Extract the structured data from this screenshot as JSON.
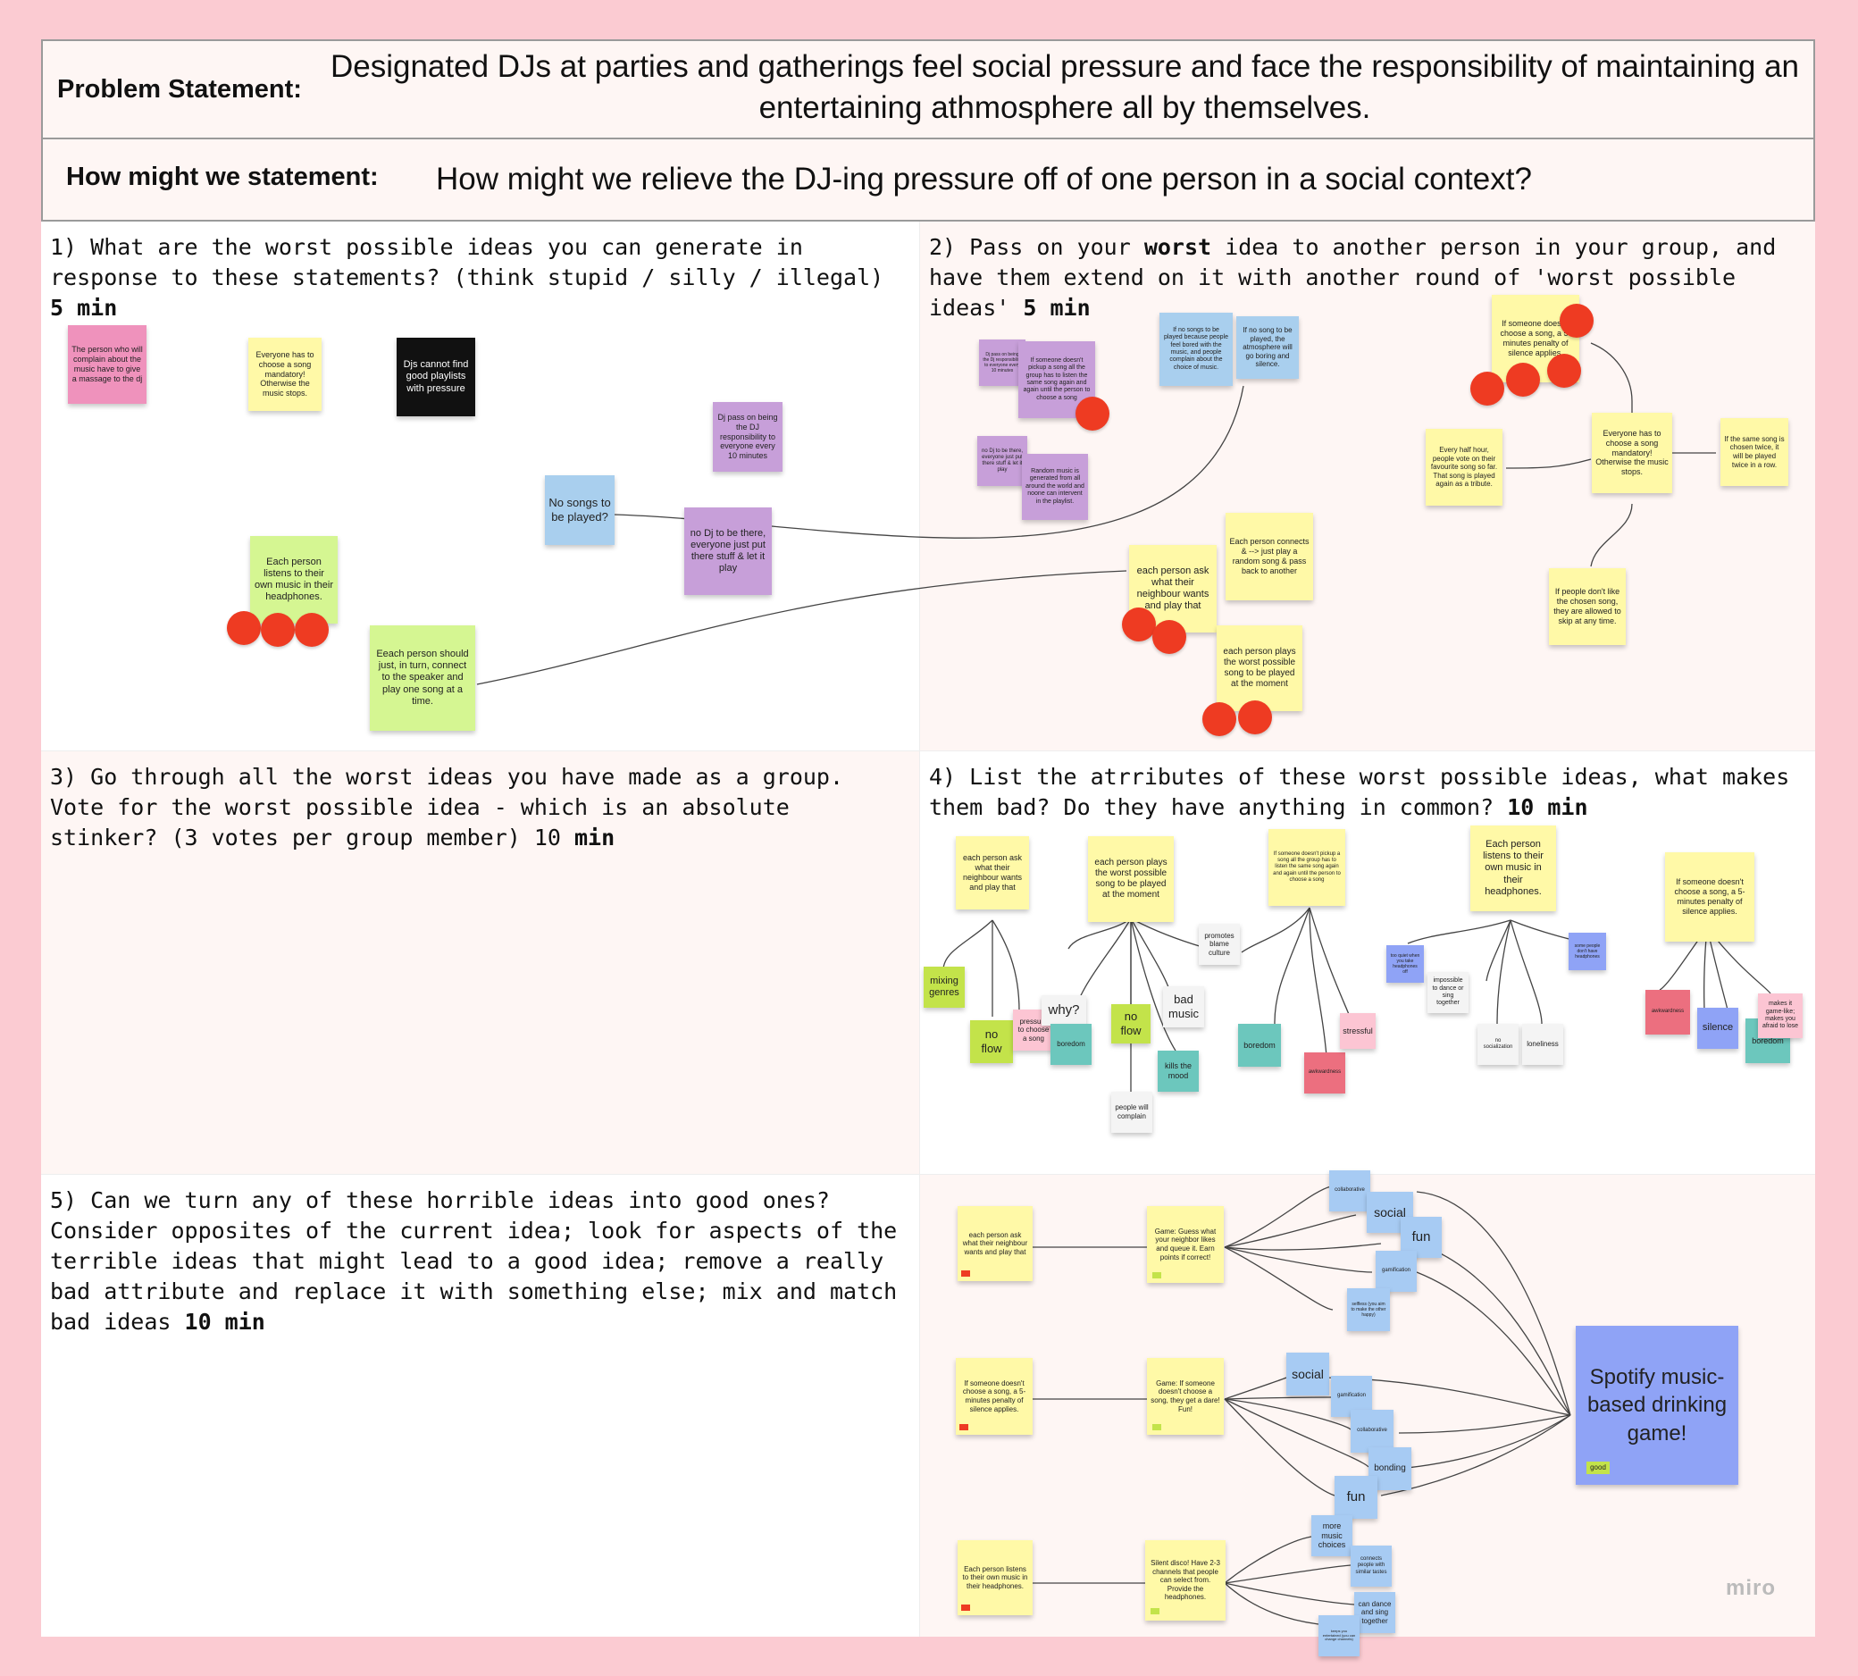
{
  "header": {
    "problem_label": "Problem Statement:",
    "problem_text": "Designated DJs at parties and gatherings feel social pressure and face the responsibility of maintaining an entertaining athmosphere all by themselves.",
    "hmw_label": "How might we statement:",
    "hmw_text": "How might we relieve the DJ-ing pressure off of one person in a social context?"
  },
  "steps": {
    "s1": {
      "text": "1) What are the worst possible ideas you can generate in\nresponse to these statements? (think stupid / silly / illegal)\n",
      "bold": "5 min"
    },
    "s2": {
      "pre": "2) Pass on your ",
      "bold1": "worst",
      "mid": " idea to another person in your group, and\nhave them extend on it with another round of 'worst possible\nideas' ",
      "bold2": "5 min"
    },
    "s3": {
      "text": "3) Go through all the worst ideas you have made as a group.\nVote for the worst possible idea - which is an absolute\nstinker? (3 votes per group member) 10 ",
      "bold": "min"
    },
    "s4": {
      "text": "4) List the atrributes of these worst possible ideas, what makes\nthem bad? Do they have anything in common? ",
      "bold": "10 min"
    },
    "s5": {
      "text": "5) Can we turn any of these horrible ideas into good ones?\nConsider opposites of the current idea; look for aspects of the\nterrible ideas that might lead to a good idea; remove a really\nbad attribute and replace it with something else; mix and match\nbad ideas ",
      "bold": "10 min"
    }
  },
  "q1_notes": {
    "n1": "The person who will complain about the music have to give a massage to the dj",
    "n2": "Everyone has to choose a song mandatory! Otherwise the music stops.",
    "n3": "Djs cannot find good playlists with pressure",
    "n4": "Dj pass on being the DJ responsibility to everyone every 10 minutes",
    "n5": "No songs to be played?",
    "n6": "no Dj to be there, everyone just put there stuff & let it play",
    "n7": "Each person listens to their own music in their headphones.",
    "n8": "Eeach person should just, in turn, connect to the speaker and play one song at a time."
  },
  "q2_notes": {
    "a1": "Dj pass on being the Dj responsibility to everyone every 10 minutes",
    "a2": "If someone doesn't pickup a song all the group has to listen the same song again and again until the person to choose a song",
    "a3": "no Dj to be there, everyone just put there stuff & let it play",
    "a4": "Random music is generated from all around the world and noone can intervent in the playlist.",
    "a5": "If no songs to be played because people feel bored with the music, and people complain about the choice of music.",
    "a6": "If no song to be played, the atmosphere will go boring and silence.",
    "a7": "Each person connects & --> just play a random song & pass back to another",
    "a8": "each person ask what their neighbour wants and play that",
    "a9": "each person plays the worst possible song to be played at the moment",
    "a10": "If someone doesn't choose a song, a 5-minutes penalty of silence applies.",
    "a11": "Every half hour, people vote on their favourite song so far. That song is played again as a tribute.",
    "a12": "Everyone has to choose a song mandatory! Otherwise the music stops.",
    "a13": "If the same song is chosen twice, it will be played twice in a row.",
    "a14": "If people don't like the chosen song, they are allowed to skip at any time."
  },
  "q4_notes": {
    "h1": "each person ask what their neighbour wants and play that",
    "h2": "each person plays the worst possible song to be played at the moment",
    "h3": "If someone doesn't pickup a song all the group has to listen the same song again and again until the person to choose a song",
    "h4": "Each person listens to their own music in their headphones.",
    "h5": "If someone doesn't choose a song, a 5-minutes penalty of silence applies.",
    "c1": "mixing genres",
    "c2": "no flow",
    "c3": "pressure to choose a song",
    "c4": "why?",
    "c5": "boredom",
    "c6": "no flow",
    "c7": "people will complain",
    "c8": "kills the mood",
    "c9": "bad music",
    "c10": "promotes blame culture",
    "c11": "boredom",
    "c12": "awkwardness",
    "c13": "stressful",
    "c14": "too quiet when you take headphones off",
    "c15": "impossible to dance or sing together",
    "c16": "no socialization",
    "c17": "loneliness",
    "c18": "some people don't have headphones",
    "c19": "awkwardness",
    "c20": "silence",
    "c21": "boredom",
    "c22": "makes it game-like; makes you afraid to lose"
  },
  "q5_notes": {
    "l1": "each person ask what their neighbour wants and play that",
    "l2": "If someone doesn't choose a song, a 5-minutes penalty of silence applies.",
    "l3": "Each person listens to their own music in their headphones.",
    "m1": "Game: Guess what your neighbor likes and queue it. Earn points if correct!",
    "m2": "Game: If someone doesn't choose a song, they get a dare! Fun!",
    "m3": "Silent disco! Have 2-3 channels that people can select from. Provide the headphones.",
    "r1": "collaborative",
    "r2": "social",
    "r3": "fun",
    "r4": "gamification",
    "r5": "selfless (you aim to make the other happy)",
    "r6": "social",
    "r7": "gamification",
    "r8": "collaborative",
    "r9": "bonding",
    "r10": "fun",
    "r11": "more music choices",
    "r12": "connects people with similar tastes",
    "r13": "can dance and sing together",
    "r14": "keeps you entertained (you can change channels)",
    "final": "Spotify music-based drinking game!",
    "good_tag": "good"
  },
  "brand": "miro",
  "colors": {
    "background": "#fbcbd2",
    "vote_dot": "#ee3b22",
    "final_note": "#8fa3f6"
  }
}
